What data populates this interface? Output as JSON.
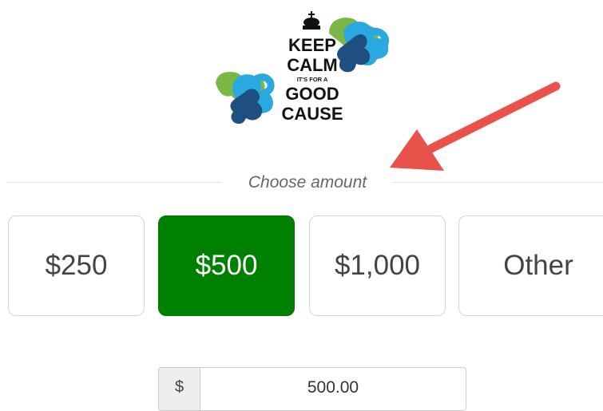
{
  "logo": {
    "line1": "KEEP",
    "line2": "CALM",
    "line3": "IT'S FOR A",
    "line4": "GOOD",
    "line5": "CAUSE",
    "icon": "crown-icon",
    "colors": {
      "green": "#7ab648",
      "light_blue": "#29a9e0",
      "dark_blue": "#1e4f80"
    }
  },
  "section": {
    "label": "Choose amount"
  },
  "amounts": [
    {
      "label": "$250",
      "selected": false
    },
    {
      "label": "$500",
      "selected": true
    },
    {
      "label": "$1,000",
      "selected": false
    },
    {
      "label": "Other",
      "selected": false
    }
  ],
  "annotation": {
    "icon": "arrow-icon",
    "color": "#e8524a"
  },
  "amount_field": {
    "prefix": "$",
    "value": "500.00"
  },
  "colors": {
    "selected": "#008000",
    "border": "#d5d5d5"
  }
}
